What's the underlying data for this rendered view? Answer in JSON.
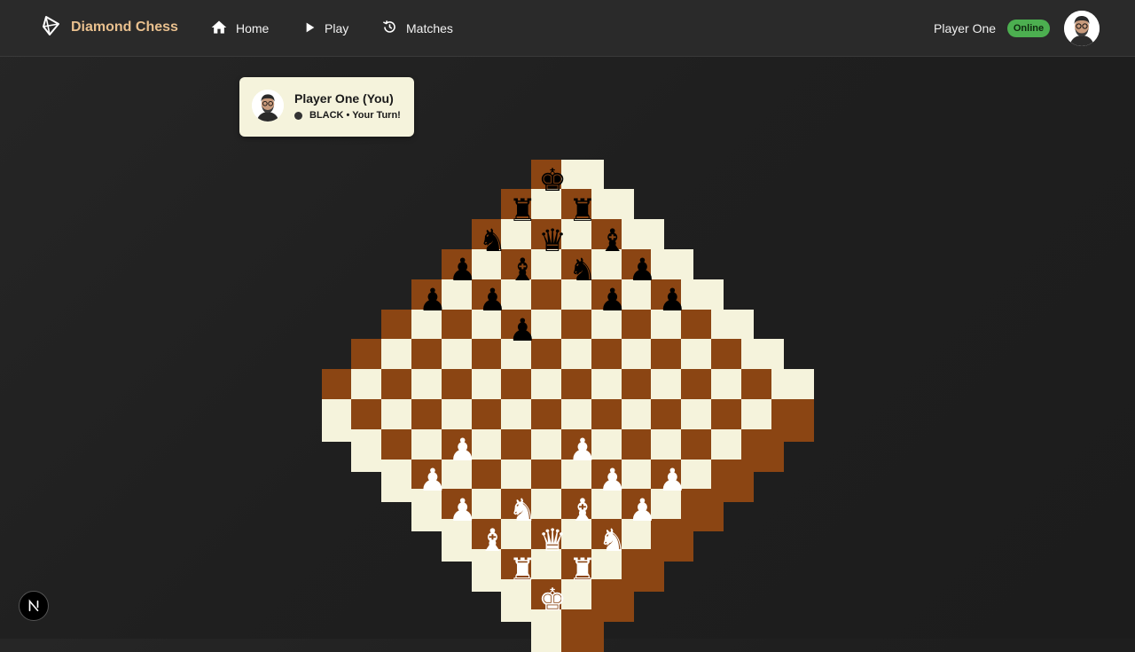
{
  "header": {
    "brand": "Diamond Chess",
    "nav": [
      {
        "label": "Home",
        "icon": "home-icon"
      },
      {
        "label": "Play",
        "icon": "play-icon"
      },
      {
        "label": "Matches",
        "icon": "history-icon"
      }
    ],
    "user_name": "Player One",
    "status": "Online"
  },
  "player_card": {
    "name": "Player One (You)",
    "status": "BLACK • Your Turn!"
  },
  "colors": {
    "dark_square": "#8b4513",
    "light_square": "#f5f3dc",
    "accent": "#e9c08e",
    "online": "#4caf50"
  },
  "board": {
    "rows": 16,
    "cols": 16,
    "pieces": [
      {
        "row": 0,
        "col": 7,
        "glyph": "♚",
        "color": "black",
        "type": "king"
      },
      {
        "row": 1,
        "col": 6,
        "glyph": "♜",
        "color": "black",
        "type": "rook"
      },
      {
        "row": 1,
        "col": 8,
        "glyph": "♜",
        "color": "black",
        "type": "rook"
      },
      {
        "row": 2,
        "col": 5,
        "glyph": "♞",
        "color": "black",
        "type": "knight"
      },
      {
        "row": 2,
        "col": 7,
        "glyph": "♛",
        "color": "black",
        "type": "queen"
      },
      {
        "row": 2,
        "col": 9,
        "glyph": "♝",
        "color": "black",
        "type": "bishop"
      },
      {
        "row": 3,
        "col": 4,
        "glyph": "♟",
        "color": "black",
        "type": "pawn"
      },
      {
        "row": 3,
        "col": 6,
        "glyph": "♝",
        "color": "black",
        "type": "bishop"
      },
      {
        "row": 3,
        "col": 8,
        "glyph": "♞",
        "color": "black",
        "type": "knight"
      },
      {
        "row": 3,
        "col": 10,
        "glyph": "♟",
        "color": "black",
        "type": "pawn"
      },
      {
        "row": 4,
        "col": 3,
        "glyph": "♟",
        "color": "black",
        "type": "pawn"
      },
      {
        "row": 4,
        "col": 5,
        "glyph": "♟",
        "color": "black",
        "type": "pawn"
      },
      {
        "row": 4,
        "col": 9,
        "glyph": "♟",
        "color": "black",
        "type": "pawn"
      },
      {
        "row": 4,
        "col": 11,
        "glyph": "♟",
        "color": "black",
        "type": "pawn"
      },
      {
        "row": 5,
        "col": 6,
        "glyph": "♟",
        "color": "black",
        "type": "pawn"
      },
      {
        "row": 9,
        "col": 4,
        "glyph": "♟",
        "color": "white",
        "type": "pawn"
      },
      {
        "row": 9,
        "col": 8,
        "glyph": "♟",
        "color": "white",
        "type": "pawn"
      },
      {
        "row": 10,
        "col": 3,
        "glyph": "♟",
        "color": "white",
        "type": "pawn"
      },
      {
        "row": 10,
        "col": 9,
        "glyph": "♟",
        "color": "white",
        "type": "pawn"
      },
      {
        "row": 10,
        "col": 11,
        "glyph": "♟",
        "color": "white",
        "type": "pawn"
      },
      {
        "row": 11,
        "col": 4,
        "glyph": "♟",
        "color": "white",
        "type": "pawn"
      },
      {
        "row": 11,
        "col": 6,
        "glyph": "♞",
        "color": "white",
        "type": "knight"
      },
      {
        "row": 11,
        "col": 8,
        "glyph": "♝",
        "color": "white",
        "type": "bishop"
      },
      {
        "row": 11,
        "col": 10,
        "glyph": "♟",
        "color": "white",
        "type": "pawn"
      },
      {
        "row": 12,
        "col": 5,
        "glyph": "♝",
        "color": "white",
        "type": "bishop"
      },
      {
        "row": 12,
        "col": 7,
        "glyph": "♛",
        "color": "white",
        "type": "queen"
      },
      {
        "row": 12,
        "col": 9,
        "glyph": "♞",
        "color": "white",
        "type": "knight"
      },
      {
        "row": 13,
        "col": 6,
        "glyph": "♜",
        "color": "white",
        "type": "rook"
      },
      {
        "row": 13,
        "col": 8,
        "glyph": "♜",
        "color": "white",
        "type": "rook"
      },
      {
        "row": 14,
        "col": 7,
        "glyph": "♚",
        "color": "white",
        "type": "king"
      }
    ]
  }
}
